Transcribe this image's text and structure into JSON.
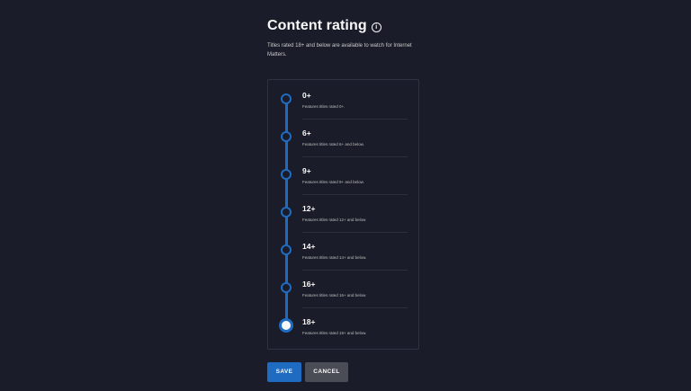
{
  "header": {
    "title": "Content rating",
    "info_icon": "info-icon",
    "subtitle": "Titles rated 18+ and below are available to watch for Internet Matters."
  },
  "ratings": {
    "selected": "18+",
    "options": [
      {
        "label": "0+",
        "description": "Features titles rated 0+."
      },
      {
        "label": "6+",
        "description": "Features titles rated 6+ and below."
      },
      {
        "label": "9+",
        "description": "Features titles rated 9+ and below."
      },
      {
        "label": "12+",
        "description": "Features titles rated 12+ and below"
      },
      {
        "label": "14+",
        "description": "Features titles rated 14+ and below."
      },
      {
        "label": "16+",
        "description": "Features titles rated 16+ and below"
      },
      {
        "label": "18+",
        "description": "Features titles rated 18+ and below."
      }
    ]
  },
  "actions": {
    "save_label": "SAVE",
    "cancel_label": "CANCEL"
  },
  "colors": {
    "background": "#1a1d29",
    "accent": "#1f6bc2",
    "cancel_button": "#4a4d56"
  }
}
